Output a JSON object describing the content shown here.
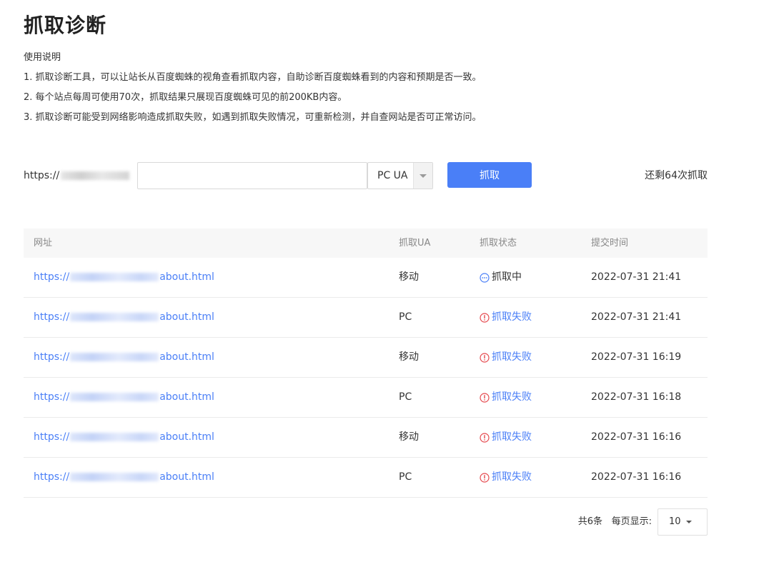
{
  "page": {
    "title": "抓取诊断"
  },
  "instructions": {
    "heading": "使用说明",
    "lines": [
      "1. 抓取诊断工具，可以让站长从百度蜘蛛的视角查看抓取内容，自助诊断百度蜘蛛看到的内容和预期是否一致。",
      "2. 每个站点每周可使用70次，抓取结果只展现百度蜘蛛可见的前200KB内容。",
      "3. 抓取诊断可能受到网络影响造成抓取失败，如遇到抓取失败情况，可重新检测，并自查网站是否可正常访问。"
    ]
  },
  "form": {
    "url_prefix": "https://",
    "url_value": "",
    "ua_selected": "PC UA",
    "fetch_label": "抓取",
    "remaining": "还剩64次抓取"
  },
  "table": {
    "headers": {
      "url": "网址",
      "ua": "抓取UA",
      "status": "抓取状态",
      "time": "提交时间"
    },
    "rows": [
      {
        "url_start": "https://",
        "url_end": "about.html",
        "ua": "移动",
        "status": "抓取中",
        "status_type": "pending",
        "time": "2022-07-31 21:41"
      },
      {
        "url_start": "https://",
        "url_end": "about.html",
        "ua": "PC",
        "status": "抓取失败",
        "status_type": "fail",
        "time": "2022-07-31 21:41"
      },
      {
        "url_start": "https://",
        "url_end": "about.html",
        "ua": "移动",
        "status": "抓取失败",
        "status_type": "fail",
        "time": "2022-07-31 16:19"
      },
      {
        "url_start": "https://",
        "url_end": "about.html",
        "ua": "PC",
        "status": "抓取失败",
        "status_type": "fail",
        "time": "2022-07-31 16:18"
      },
      {
        "url_start": "https://",
        "url_end": "about.html",
        "ua": "移动",
        "status": "抓取失败",
        "status_type": "fail",
        "time": "2022-07-31 16:16"
      },
      {
        "url_start": "https://",
        "url_end": "about.html",
        "ua": "PC",
        "status": "抓取失败",
        "status_type": "fail",
        "time": "2022-07-31 16:16"
      }
    ]
  },
  "pagination": {
    "total": "共6条",
    "per_page_label": "每页显示:",
    "page_size": "10"
  },
  "colors": {
    "accent": "#4a7ff7",
    "fail": "#e5484d",
    "pending_icon": "#4a7ff7"
  }
}
